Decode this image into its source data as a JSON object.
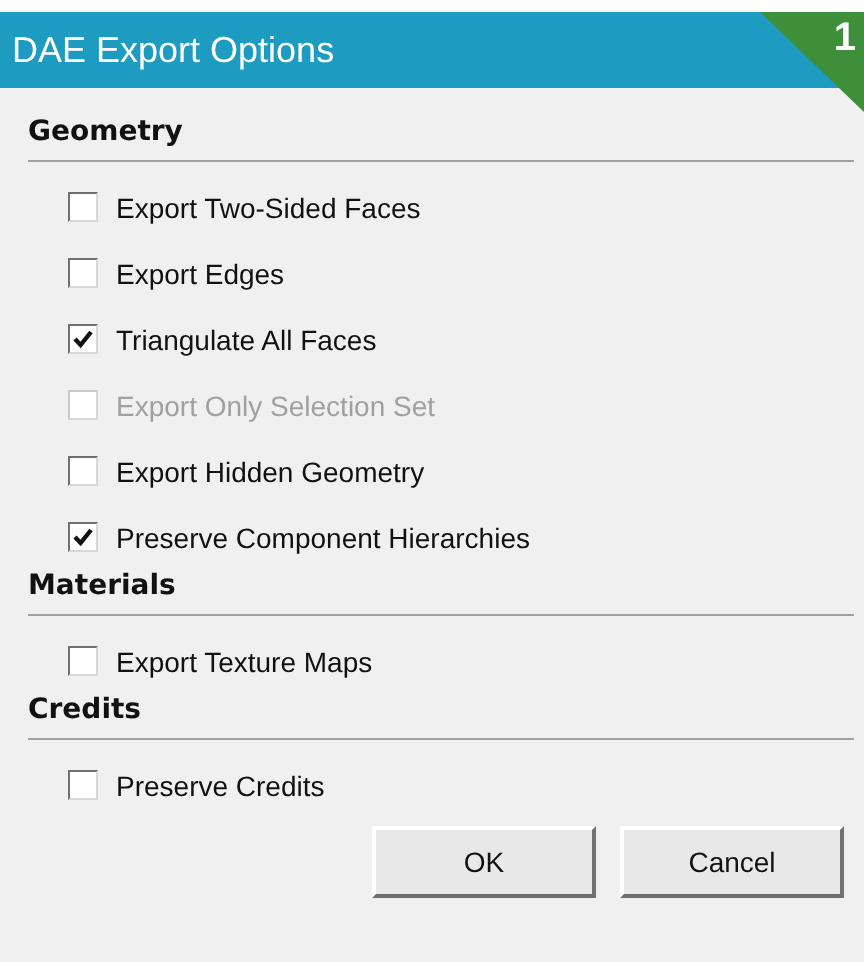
{
  "window": {
    "title": "DAE Export Options"
  },
  "badge": "1",
  "sections": [
    {
      "title": "Geometry",
      "options": [
        {
          "label": "Export Two-Sided Faces",
          "checked": false,
          "disabled": false
        },
        {
          "label": "Export Edges",
          "checked": false,
          "disabled": false
        },
        {
          "label": "Triangulate All Faces",
          "checked": true,
          "disabled": false
        },
        {
          "label": "Export Only Selection Set",
          "checked": false,
          "disabled": true
        },
        {
          "label": "Export Hidden Geometry",
          "checked": false,
          "disabled": false
        },
        {
          "label": "Preserve Component Hierarchies",
          "checked": true,
          "disabled": false
        }
      ]
    },
    {
      "title": "Materials",
      "options": [
        {
          "label": "Export Texture Maps",
          "checked": false,
          "disabled": false
        }
      ]
    },
    {
      "title": "Credits",
      "options": [
        {
          "label": "Preserve Credits",
          "checked": false,
          "disabled": false
        }
      ]
    }
  ],
  "buttons": [
    "OK",
    "Cancel"
  ]
}
